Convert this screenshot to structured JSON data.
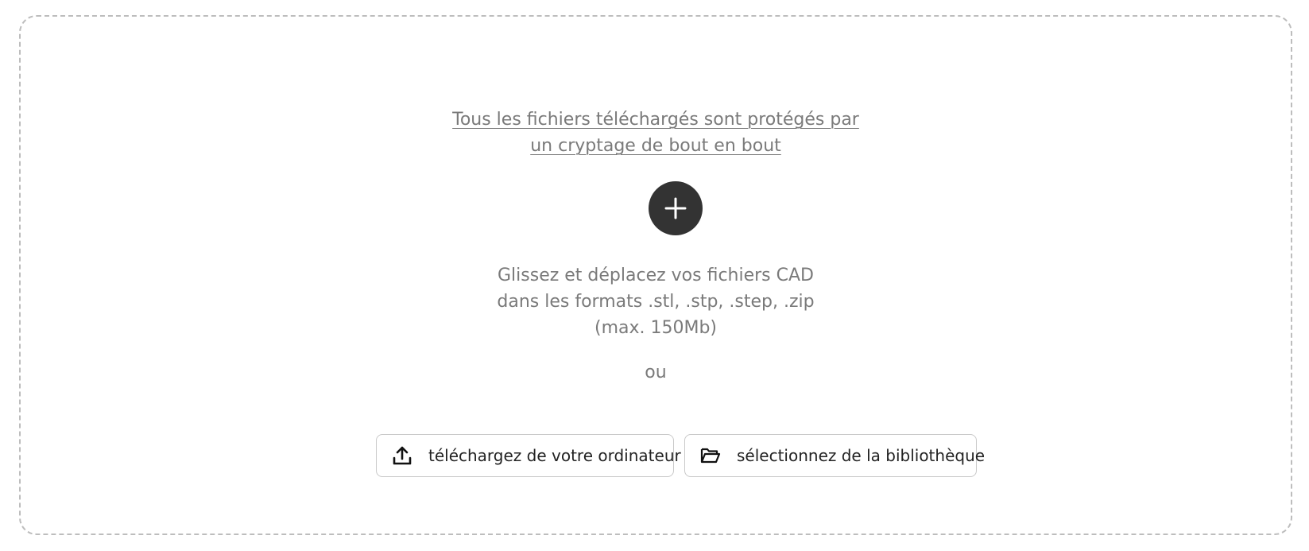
{
  "dropzone": {
    "security_line1": "Tous les fichiers téléchargés sont protégés par",
    "security_line2": "un cryptage de bout en bout",
    "add_icon": "plus-icon",
    "instructions_line1": "Glissez et déplacez vos fichiers CAD",
    "instructions_line2": "dans les formats .stl, .stp, .step, .zip",
    "instructions_line3": "(max. 150Mb)",
    "or_text": "ou",
    "upload_button": {
      "label": "téléchargez de votre ordinateur",
      "icon": "upload-icon"
    },
    "library_button": {
      "label": "sélectionnez de la bibliothèque",
      "icon": "folder-open-icon"
    }
  },
  "colors": {
    "border": "#bdbdbd",
    "muted_text": "#7a7a7a",
    "add_button_bg": "#333333",
    "button_text": "#222222"
  }
}
